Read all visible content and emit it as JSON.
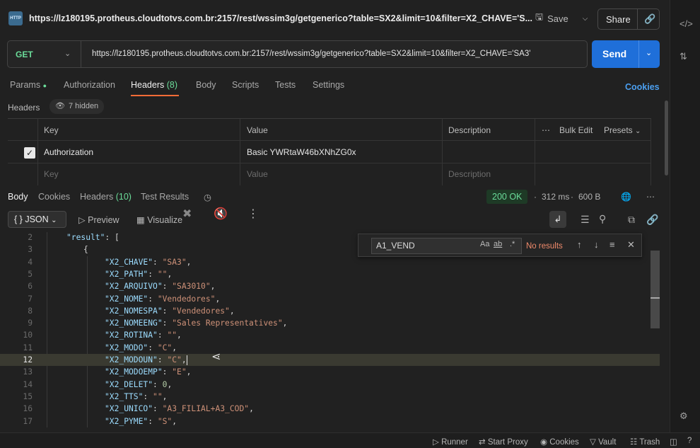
{
  "tab": {
    "icon_text": "HTTP",
    "title": "https://lz180195.protheus.cloudtotvs.com.br:2157/rest/wssim3g/getgenerico?table=SX2&limit=10&filter=X2_CHAVE='S..."
  },
  "topbar": {
    "save_label": "Save",
    "share_label": "Share"
  },
  "request": {
    "method": "GET",
    "url": "https://lz180195.protheus.cloudtotvs.com.br:2157/rest/wssim3g/getgenerico?table=SX2&limit=10&filter=X2_CHAVE='SA3'",
    "send_label": "Send"
  },
  "request_tabs": [
    {
      "label": "Params"
    },
    {
      "label": "Authorization"
    },
    {
      "label": "Headers",
      "count": "(8)"
    },
    {
      "label": "Body"
    },
    {
      "label": "Scripts"
    },
    {
      "label": "Tests"
    },
    {
      "label": "Settings"
    }
  ],
  "cookies_link": "Cookies",
  "headers_section": {
    "title": "Headers",
    "hidden_chip": "7 hidden",
    "columns": [
      "Key",
      "Value",
      "Description"
    ],
    "bulk_edit": "Bulk Edit",
    "presets": "Presets",
    "row": {
      "key": "Authorization",
      "value": "Basic YWRtaW46bXNhZG0x"
    },
    "placeholder": {
      "key": "Key",
      "value": "Value",
      "description": "Description"
    }
  },
  "response_tabs": [
    {
      "label": "Body"
    },
    {
      "label": "Cookies"
    },
    {
      "label": "Headers",
      "count": "(10)"
    },
    {
      "label": "Test Results"
    }
  ],
  "response_meta": {
    "status": "200 OK",
    "time": "312 ms",
    "size": "600 B"
  },
  "response_toolbar": {
    "format": "JSON",
    "preview": "Preview",
    "visualize": "Visualize"
  },
  "find": {
    "query": "A1_VEND",
    "match_case": "Aa",
    "whole_word": "ab",
    "regex": ".*",
    "no_results": "No results"
  },
  "code_lines": [
    {
      "n": "2",
      "key": "\"result\"",
      "rest": ": ["
    },
    {
      "n": "3",
      "key": "",
      "rest": "{"
    },
    {
      "n": "4",
      "key": "\"X2_CHAVE\"",
      "val": "\"SA3\"",
      "tail": ","
    },
    {
      "n": "5",
      "key": "\"X2_PATH\"",
      "val": "\"\"",
      "tail": ","
    },
    {
      "n": "6",
      "key": "\"X2_ARQUIVO\"",
      "val": "\"SA3010\"",
      "tail": ","
    },
    {
      "n": "7",
      "key": "\"X2_NOME\"",
      "val": "\"Vendedores\"",
      "tail": ","
    },
    {
      "n": "8",
      "key": "\"X2_NOMESPA\"",
      "val": "\"Vendedores\"",
      "tail": ","
    },
    {
      "n": "9",
      "key": "\"X2_NOMEENG\"",
      "val": "\"Sales Representatives\"",
      "tail": ","
    },
    {
      "n": "10",
      "key": "\"X2_ROTINA\"",
      "val": "\"\"",
      "tail": ","
    },
    {
      "n": "11",
      "key": "\"X2_MODO\"",
      "val": "\"C\"",
      "tail": ","
    },
    {
      "n": "12",
      "key": "\"X2_MODOUN\"",
      "val": "\"C\"",
      "tail": ","
    },
    {
      "n": "13",
      "key": "\"X2_MODOEMP\"",
      "val": "\"E\"",
      "tail": ","
    },
    {
      "n": "14",
      "key": "\"X2_DELET\"",
      "num": "0",
      "tail": ","
    },
    {
      "n": "15",
      "key": "\"X2_TTS\"",
      "val": "\"\"",
      "tail": ","
    },
    {
      "n": "16",
      "key": "\"X2_UNICO\"",
      "val": "\"A3_FILIAL+A3_COD\"",
      "tail": ","
    },
    {
      "n": "17",
      "key": "\"X2_PYME\"",
      "val": "\"S\"",
      "tail": ","
    }
  ],
  "statusbar": [
    "Runner",
    "Start Proxy",
    "Cookies",
    "Vault",
    "Trash"
  ]
}
